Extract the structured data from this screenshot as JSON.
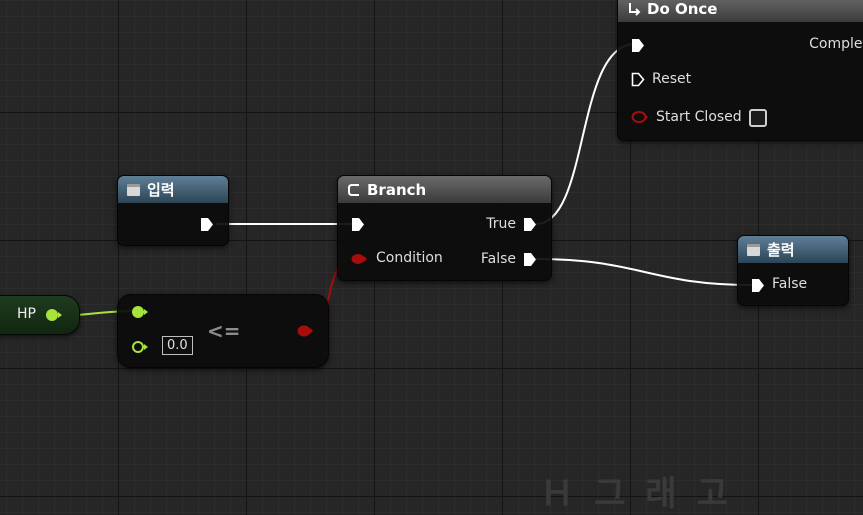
{
  "colors": {
    "exec": "#ffffff",
    "float": "#a8e33c",
    "bool": "#a60d0d",
    "node_header_blue": "#4c6b84",
    "node_header_grey": "#555555"
  },
  "do_once": {
    "title": "Do Once",
    "icon": "do-once-icon",
    "outputs": {
      "completed": "Complet"
    },
    "inputs": {
      "reset": "Reset",
      "start_closed": "Start Closed"
    },
    "start_closed_checked": false
  },
  "input_event": {
    "title": "입력",
    "icon": "event-box-icon"
  },
  "branch": {
    "title": "Branch",
    "icon": "branch-icon",
    "inputs": {
      "condition": "Condition"
    },
    "outputs": {
      "true": "True",
      "false": "False"
    }
  },
  "output_event": {
    "title": "출력",
    "icon": "event-box-icon",
    "inputs": {
      "false": "False"
    }
  },
  "hp_variable": {
    "label": "HP"
  },
  "compare": {
    "operator": "<=",
    "value": "0.0"
  },
  "watermark": {
    "text": "Ｈ그래고"
  }
}
